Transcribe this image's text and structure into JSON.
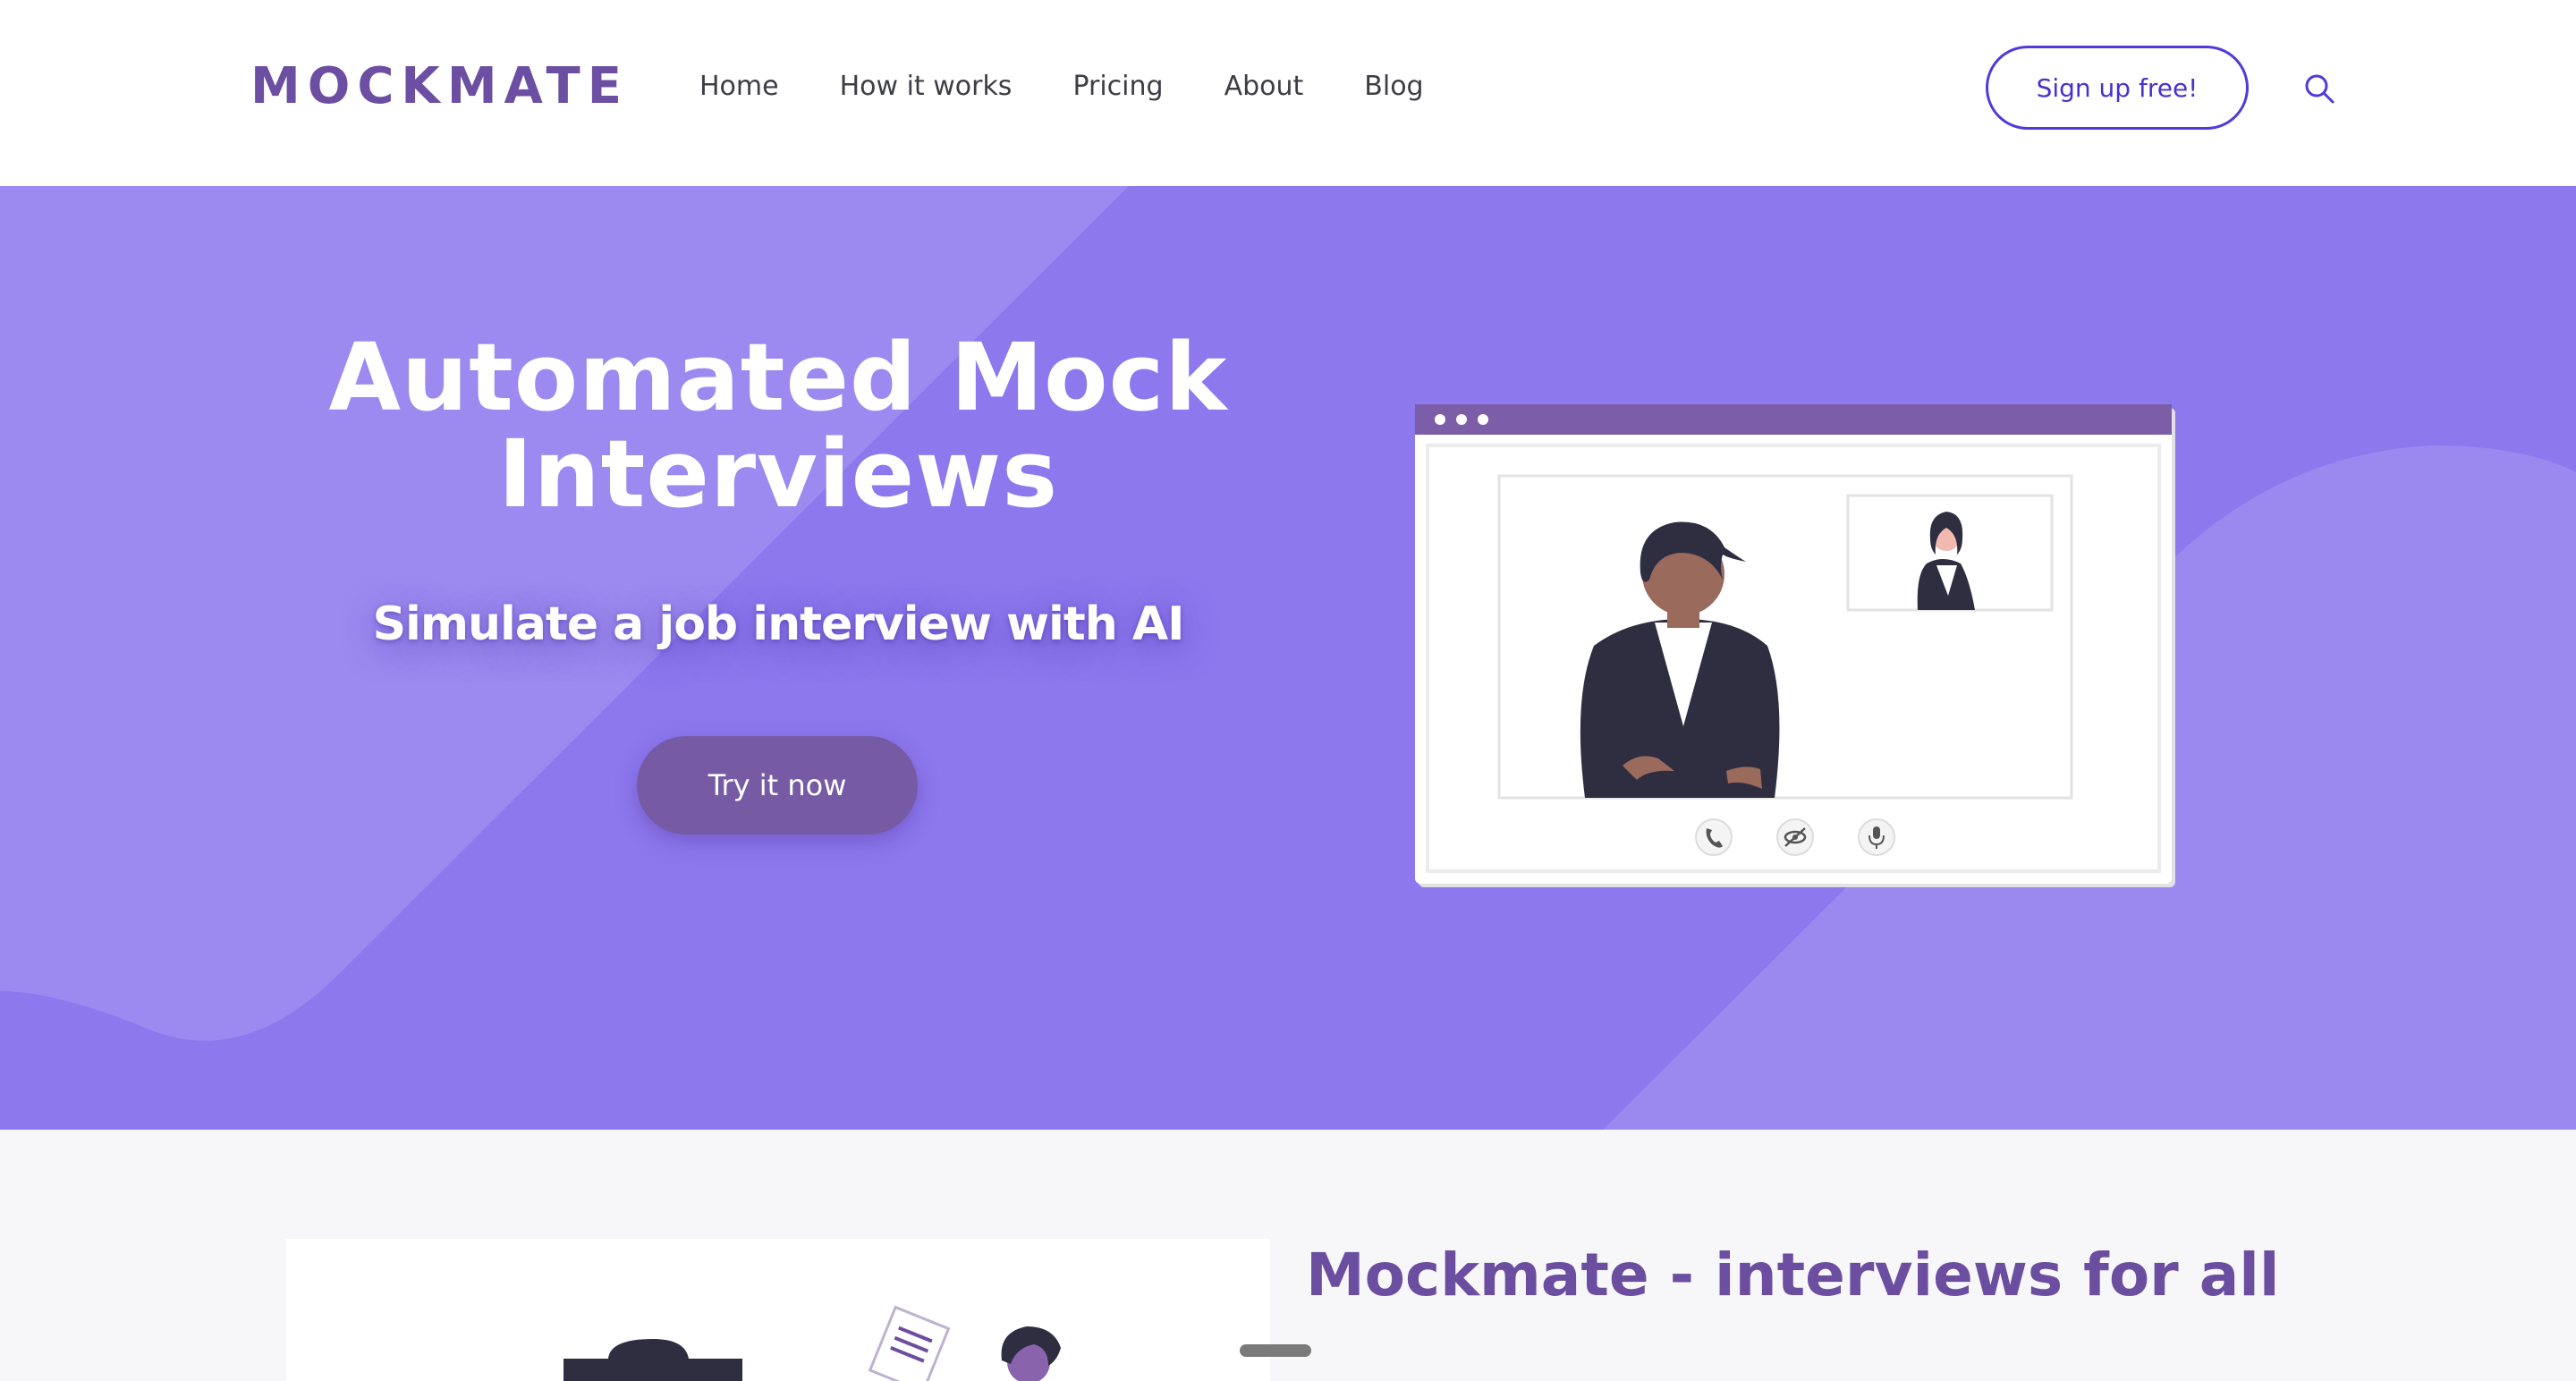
{
  "header": {
    "logo_text": "MOCKMATE",
    "nav": [
      {
        "label": "Home"
      },
      {
        "label": "How it works"
      },
      {
        "label": "Pricing"
      },
      {
        "label": "About"
      },
      {
        "label": "Blog"
      }
    ],
    "signup_label": "Sign up free!",
    "search_icon": "search-icon"
  },
  "hero": {
    "title_line1": "Automated Mock",
    "title_line2": "Interviews",
    "subtitle": "Simulate a job interview with AI",
    "cta_label": "Try it now",
    "illustration": "video-call-interview-illustration",
    "call_controls": [
      "phone-icon",
      "eye-slash-icon",
      "microphone-icon"
    ]
  },
  "section": {
    "title": "Mockmate - interviews for all",
    "illustration": "person-with-document-illustration"
  },
  "colors": {
    "brand_purple": "#6c4fa3",
    "hero_bg": "#8d78ee",
    "cta_bg": "#765ba4",
    "signup_border": "#5438d9",
    "window_bar": "#7b5ea7"
  }
}
